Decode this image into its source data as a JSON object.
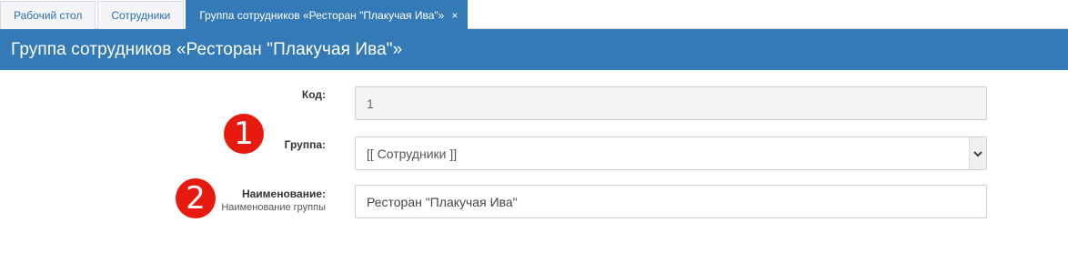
{
  "tabs": [
    {
      "label": "Рабочий стол",
      "active": false
    },
    {
      "label": "Сотрудники",
      "active": false
    },
    {
      "label": "Группа сотрудников «Ресторан \"Плакучая Ива\"»",
      "active": true,
      "close_icon": "×"
    }
  ],
  "page": {
    "title": "Группа сотрудников «Ресторан \"Плакучая Ива\"»"
  },
  "form": {
    "code": {
      "label": "Код:",
      "value": "1",
      "readonly": true
    },
    "group": {
      "label": "Группа:",
      "value": "[[ Сотрудники ]]",
      "icon": "chevron-down-icon"
    },
    "name": {
      "label": "Наименование:",
      "hint": "Наименование группы",
      "value": "Ресторан \"Плакучая Ива\""
    }
  },
  "annotations": [
    {
      "number": "1"
    },
    {
      "number": "2"
    }
  ],
  "colors": {
    "accent": "#337ab7",
    "badge": "#e8190f",
    "tab_link": "#2f6fae",
    "readonly_bg": "#f4f4f4"
  }
}
